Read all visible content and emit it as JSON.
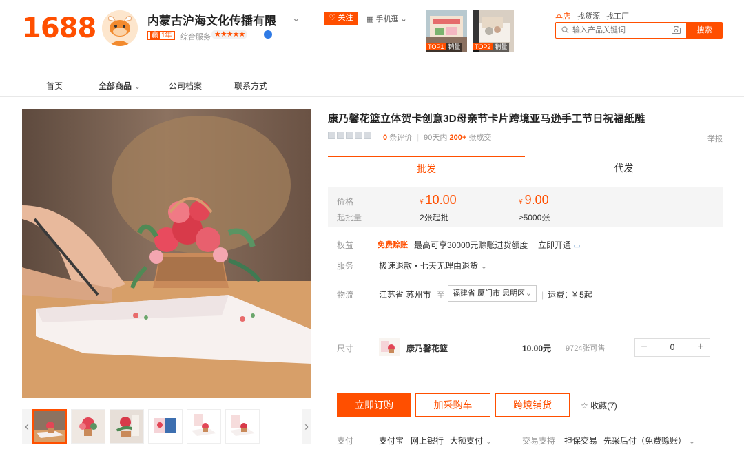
{
  "header": {
    "logo": "1688",
    "shop_name": "内蒙古沪海文化传播有限",
    "years_icon": "赢",
    "years": "1年",
    "rating_label": "综合服务",
    "rating_stars": "★★★★★",
    "follow": "关注",
    "mobile": "手机逛",
    "top_items": [
      {
        "rank": "TOP1",
        "label": "销量"
      },
      {
        "rank": "TOP2",
        "label": "销量"
      }
    ],
    "search_tabs": [
      "本店",
      "找货源",
      "找工厂"
    ],
    "search_placeholder": "输入产品关键词",
    "search_button": "搜索"
  },
  "nav": [
    "首页",
    "全部商品",
    "公司档案",
    "联系方式"
  ],
  "product": {
    "title": "康乃馨花篮立体贺卡创意3D母亲节卡片跨境亚马逊手工节日祝福纸雕",
    "review_count": "0",
    "review_label": "条评价",
    "sold_period": "90天内",
    "sold_count": "200+",
    "sold_unit": "张成交",
    "report": "举报",
    "tabs": [
      "批发",
      "代发"
    ],
    "price_label": "价格",
    "moq_label": "起批量",
    "currency": "¥",
    "tiers": [
      {
        "price": "10.00",
        "moq": "2张起批"
      },
      {
        "price": "9.00",
        "moq": "≥5000张"
      }
    ],
    "benefit_label": "权益",
    "benefit_tag": "免费赊账",
    "benefit_text": "最高可享30000元赊账进货额度",
    "benefit_link": "立即开通",
    "service_label": "服务",
    "service_text": "极速退款・七天无理由退货",
    "logistics_label": "物流",
    "ship_from": "江苏省 苏州市",
    "ship_to_word": "至",
    "ship_to": "福建省 厦门市 思明区",
    "ship_fee": "运费：¥ 5起",
    "size_label": "尺寸",
    "sku": {
      "name": "康乃馨花篮",
      "price": "10.00元",
      "stock": "9724张可售",
      "qty": "0"
    },
    "buttons": {
      "buy": "立即订购",
      "cart": "加采购车",
      "cross": "跨境铺货",
      "collect": "收藏(7)"
    },
    "pay_label": "支付",
    "pay_methods": [
      "支付宝",
      "网上银行",
      "大额支付"
    ],
    "trade_label": "交易支持",
    "trade_items": [
      "担保交易",
      "先采后付（免费赊账）"
    ]
  },
  "colors": {
    "brand": "#ff4f00"
  }
}
